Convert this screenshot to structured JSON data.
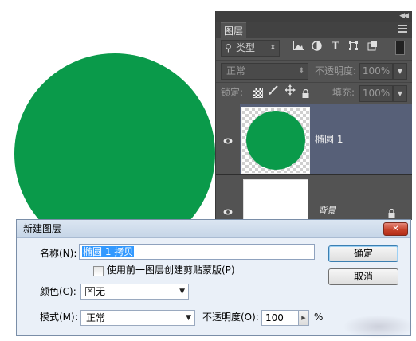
{
  "canvas": {
    "shape_color": "#0a9a4a"
  },
  "layers_panel": {
    "tab_label": "图层",
    "filter": {
      "label": "类型"
    },
    "blend_mode": "正常",
    "opacity_label": "不透明度:",
    "opacity_value": "100%",
    "lock_label": "锁定:",
    "fill_label": "填充:",
    "fill_value": "100%",
    "layers": [
      {
        "name": "椭圆 1",
        "visible": true,
        "selected": true
      },
      {
        "name": "背景",
        "visible": true,
        "locked": true
      }
    ]
  },
  "dialog": {
    "title": "新建图层",
    "name_label": "名称(N):",
    "name_value": "椭圆 1 拷贝",
    "clip_checkbox_label": "使用前一图层创建剪贴蒙版(P)",
    "clip_checked": false,
    "color_label": "颜色(C):",
    "color_value": "无",
    "mode_label": "模式(M):",
    "mode_value": "正常",
    "opacity_label": "不透明度(O):",
    "opacity_value": "100",
    "percent": "%",
    "ok_label": "确定",
    "cancel_label": "取消",
    "close_symbol": "✕"
  }
}
